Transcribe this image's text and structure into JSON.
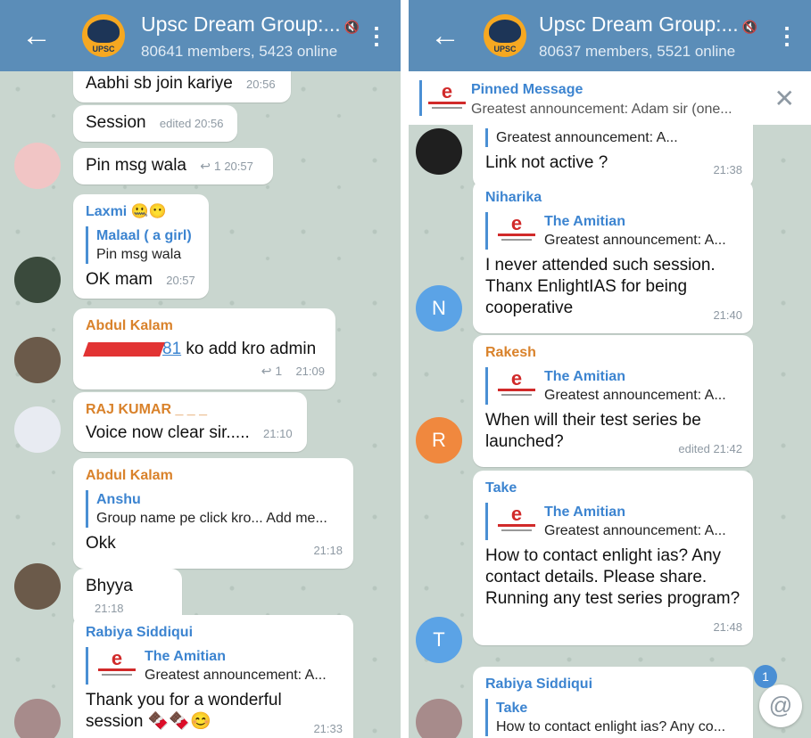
{
  "left": {
    "header": {
      "back_icon": "←",
      "title": "Upsc Dream Group:...",
      "mute_icon": "🔇",
      "subtitle": "80641 members, 5423 online",
      "logo_text": "UPSC",
      "menu_icon": "⋮"
    },
    "messages": [
      {
        "text": "Aabhi sb join kariye",
        "time": "20:56"
      },
      {
        "text": "Session",
        "time": "edited 20:56"
      },
      {
        "text": "Pin msg wala",
        "replies": "↩ 1",
        "time": "20:57"
      },
      {
        "sender": "Laxmi 🤐😶",
        "reply_name": "Malaal ( a girl)",
        "reply_text": "Pin msg wala",
        "text": "OK mam",
        "time": "20:57"
      },
      {
        "sender": "Abdul Kalam",
        "link": "81",
        "text": " ko add kro admin",
        "replies": "↩ 1",
        "time": "21:09"
      },
      {
        "sender": "RAJ KUMAR _ _ _",
        "text": "Voice now clear sir.....",
        "time": "21:10"
      },
      {
        "sender": "Abdul Kalam",
        "reply_name": "Anshu",
        "reply_text": "Group name pe click kro... Add me...",
        "text": "Okk",
        "time": "21:18"
      },
      {
        "text": "Bhyya",
        "time": "21:18"
      },
      {
        "sender": "Rabiya Siddiqui",
        "reply_name": "The Amitian",
        "reply_text": "Greatest announcement: A...",
        "text": "Thank you for a wonderful session 🍫🍫😊",
        "time": "21:33"
      }
    ],
    "colors": {
      "laxmi": "#3c84d0",
      "abdul": "#d9822b",
      "raj": "#d9822b",
      "rabiya": "#3c84d0"
    }
  },
  "right": {
    "header": {
      "back_icon": "←",
      "title": "Upsc Dream Group:...",
      "mute_icon": "🔇",
      "subtitle": "80637 members, 5521 online",
      "logo_text": "UPSC",
      "menu_icon": "⋮"
    },
    "pinned": {
      "label": "Pinned Message",
      "text": "Greatest announcement:  Adam sir (one...",
      "close_icon": "✕"
    },
    "messages": [
      {
        "reply_text": "Greatest announcement: A...",
        "text": "Link not active ?",
        "time": "21:38"
      },
      {
        "sender": "Niharika",
        "reply_name": "The Amitian",
        "reply_text": "Greatest announcement: A...",
        "text": "I never attended such session. Thanx EnlightIAS for being cooperative",
        "time": "21:40",
        "avatar_letter": "N"
      },
      {
        "sender": "Rakesh",
        "reply_name": "The Amitian",
        "reply_text": "Greatest announcement: A...",
        "text": "When will their test series be launched?",
        "time": "edited 21:42",
        "avatar_letter": "R"
      },
      {
        "sender": "Take",
        "reply_name": "The Amitian",
        "reply_text": "Greatest announcement: A...",
        "text": "How to contact enlight ias? Any contact details. Please share. Running any test series program?",
        "time": "21:48",
        "avatar_letter": "T"
      },
      {
        "sender": "Rabiya Siddiqui",
        "reply_name": "Take",
        "reply_text": "How to contact enlight ias? Any co..."
      }
    ],
    "fab_icon": "@",
    "badge_count": "1",
    "colors": {
      "niharika": "#3c84d0",
      "rakesh": "#d9822b",
      "take": "#3c84d0",
      "rabiya": "#3c84d0",
      "avatar_n": "#5ba3e6",
      "avatar_r": "#f0883e",
      "avatar_t": "#5ba3e6"
    }
  }
}
